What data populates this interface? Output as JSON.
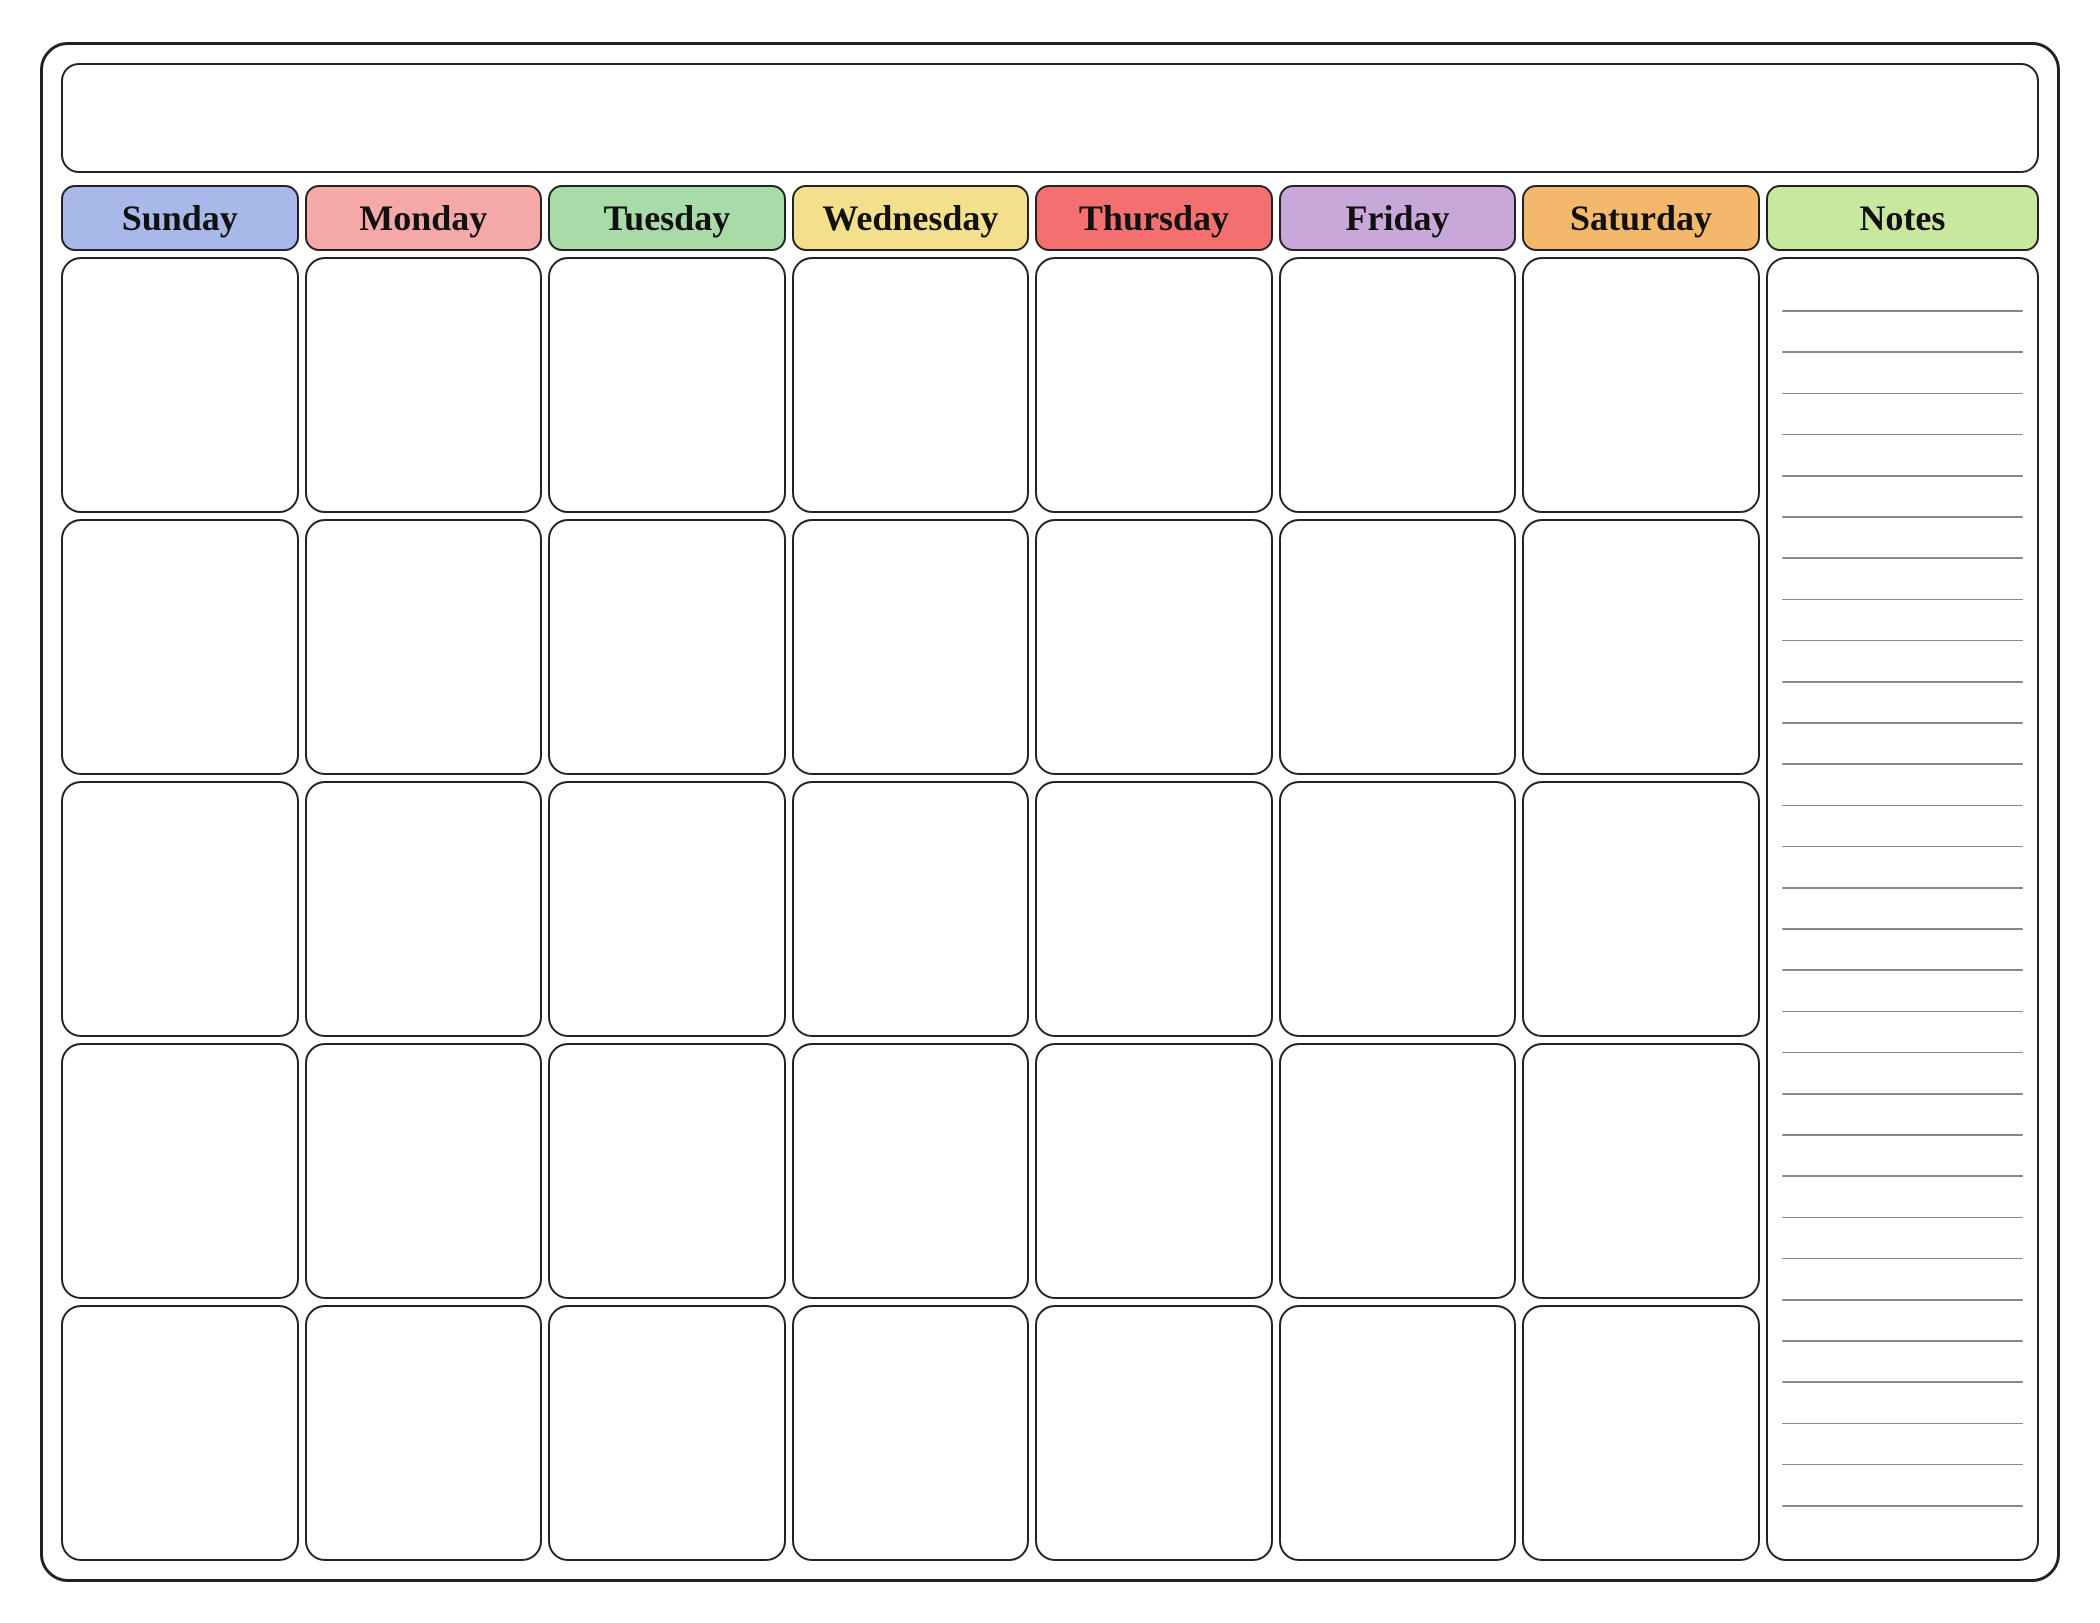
{
  "header": {
    "title_placeholder": ""
  },
  "days": {
    "sunday": {
      "label": "Sunday",
      "color_class": "col-sunday"
    },
    "monday": {
      "label": "Monday",
      "color_class": "col-monday"
    },
    "tuesday": {
      "label": "Tuesday",
      "color_class": "col-tuesday"
    },
    "wednesday": {
      "label": "Wednesday",
      "color_class": "col-wednesday"
    },
    "thursday": {
      "label": "Thursday",
      "color_class": "col-thursday"
    },
    "friday": {
      "label": "Friday",
      "color_class": "col-friday"
    },
    "saturday": {
      "label": "Saturday",
      "color_class": "col-saturday"
    },
    "notes": {
      "label": "Notes",
      "color_class": "col-notes"
    }
  },
  "grid_rows": 5,
  "grid_cols": 7,
  "notes_lines": 30
}
